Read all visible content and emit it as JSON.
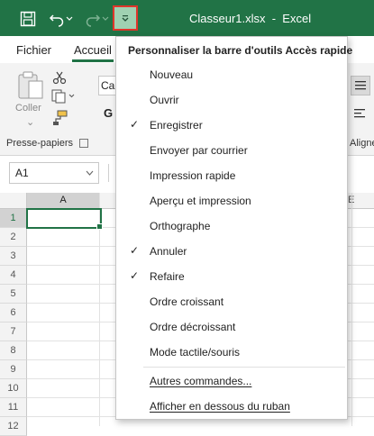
{
  "window": {
    "title": "Classeur1.xlsx  -  Excel"
  },
  "colors": {
    "excel_green": "#217346",
    "highlight": "#9fd1b2",
    "outline": "#e0352b"
  },
  "tabs": [
    {
      "label": "Fichier"
    },
    {
      "label": "Accueil"
    }
  ],
  "ribbon": {
    "paste_label": "Coller",
    "clipboard_group": "Presse-papiers",
    "font_partial": "Ca",
    "bold_partial": "G",
    "align_group_partial": "Aligne"
  },
  "formula_bar": {
    "name_box": "A1"
  },
  "sheet": {
    "column_a": "A",
    "column_e_partial": "E",
    "rows": [
      "1",
      "2",
      "3",
      "4",
      "5",
      "6",
      "7",
      "8",
      "9",
      "10",
      "11",
      "12"
    ]
  },
  "menu": {
    "title": "Personnaliser la barre d'outils Accès rapide",
    "items": [
      {
        "label": "Nouveau",
        "checked": false
      },
      {
        "label": "Ouvrir",
        "checked": false
      },
      {
        "label": "Enregistrer",
        "checked": true
      },
      {
        "label": "Envoyer par courrier",
        "checked": false
      },
      {
        "label": "Impression rapide",
        "checked": false
      },
      {
        "label": "Aperçu et impression",
        "checked": false
      },
      {
        "label": "Orthographe",
        "checked": false
      },
      {
        "label": "Annuler",
        "checked": true
      },
      {
        "label": "Refaire",
        "checked": true
      },
      {
        "label": "Ordre croissant",
        "checked": false
      },
      {
        "label": "Ordre décroissant",
        "checked": false
      },
      {
        "label": "Mode tactile/souris",
        "checked": false
      }
    ],
    "more_commands": "Autres commandes...",
    "show_below": "Afficher en dessous du ruban",
    "check_glyph": "✓"
  }
}
